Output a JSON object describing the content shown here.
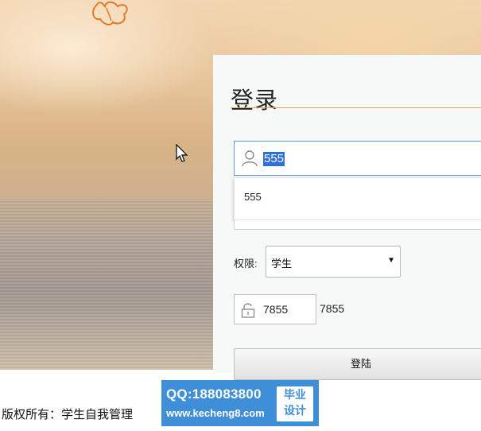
{
  "login": {
    "title": "登录",
    "username_value": "555",
    "suggestion": "555",
    "role_label": "权限:",
    "role_selected": "学生",
    "code_value": "7855",
    "code_display": "7855",
    "submit_label": "登陆"
  },
  "footer": {
    "copyright": "版权所有：学生自我管理"
  },
  "watermark": {
    "qq": "QQ:188083800",
    "url": "www.kecheng8.com",
    "box_line1": "毕业",
    "box_line2": "设计"
  },
  "colors": {
    "focus_border": "#5a9ae0",
    "selection": "#2f6fd6",
    "title_underline": "#e4a25a",
    "watermark_bg": "#3f8fd8"
  }
}
